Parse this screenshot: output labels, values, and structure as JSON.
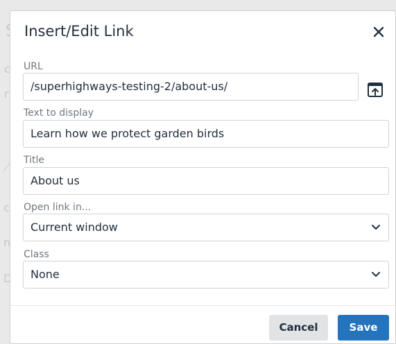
{
  "dialog": {
    "title": "Insert/Edit Link",
    "close_icon": "close-icon"
  },
  "fields": {
    "url": {
      "label": "URL",
      "value": "/superhighways-testing-2/about-us/",
      "browse_icon": "browse-upload-icon"
    },
    "text": {
      "label": "Text to display",
      "value": "Learn how we protect garden birds"
    },
    "title": {
      "label": "Title",
      "value": "About us"
    },
    "open_in": {
      "label": "Open link in...",
      "value": "Current window"
    },
    "class": {
      "label": "Class",
      "value": "None"
    }
  },
  "footer": {
    "cancel_label": "Cancel",
    "save_label": "Save"
  },
  "colors": {
    "primary": "#2473bd",
    "secondary": "#e1e3e5",
    "text": "#222f3e"
  }
}
